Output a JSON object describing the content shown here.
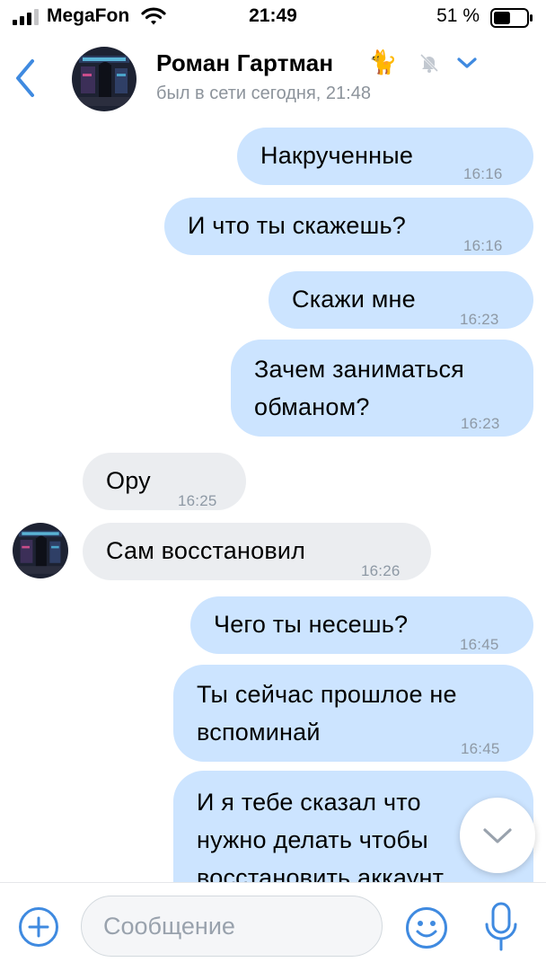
{
  "status_bar": {
    "carrier": "MegaFon",
    "time": "21:49",
    "battery_percent": "51 %",
    "battery_level": 0.51
  },
  "header": {
    "name": "Роман Гартман",
    "name_emoji": "🐈",
    "status": "был в сети сегодня, 21:48",
    "muted": true
  },
  "messages": [
    {
      "direction": "out",
      "text": "Накрученные",
      "time": "16:16"
    },
    {
      "direction": "out",
      "text": "И что ты скажешь?",
      "time": "16:16"
    },
    {
      "direction": "out",
      "text": "Скажи мне",
      "time": "16:23"
    },
    {
      "direction": "out",
      "lines": [
        "Зачем заниматься",
        "обманом?"
      ],
      "time": "16:23"
    },
    {
      "direction": "in",
      "text": "Ору",
      "time": "16:25"
    },
    {
      "direction": "in",
      "text": "Сам восстановил",
      "time": "16:26"
    },
    {
      "direction": "out",
      "text": "Чего ты несешь?",
      "time": "16:45"
    },
    {
      "direction": "out",
      "lines": [
        "Ты сейчас прошлое не",
        "вспоминай"
      ],
      "time": "16:45"
    },
    {
      "direction": "out",
      "lines": [
        "И я тебе сказал что",
        "нужно делать чтобы",
        "восстановить аккаунт"
      ]
    }
  ],
  "input": {
    "placeholder": "Сообщение"
  },
  "icons": {
    "back": "chevron-left-icon",
    "mute": "bell-slash-icon",
    "dropdown": "chevron-down-icon",
    "add": "plus-circle-icon",
    "emoji": "smile-icon",
    "mic": "microphone-icon",
    "scroll_down": "chevron-down-icon"
  },
  "colors": {
    "accent": "#3f8ae0",
    "outgoing_bubble": "#cce4ff",
    "incoming_bubble": "#ebedf0",
    "secondary_text": "#8c939b"
  }
}
